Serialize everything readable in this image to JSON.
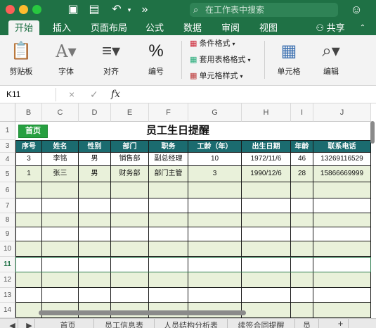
{
  "search": {
    "placeholder": "在工作表中搜索"
  },
  "colors": {
    "accent": "#1f7145",
    "header_fill": "#1b6b6f",
    "band_fill": "#e9f1da",
    "home_button": "#27a041"
  },
  "tabs": [
    {
      "label": "开始",
      "active": true
    },
    {
      "label": "插入"
    },
    {
      "label": "页面布局"
    },
    {
      "label": "公式"
    },
    {
      "label": "数据"
    },
    {
      "label": "审阅"
    },
    {
      "label": "视图"
    }
  ],
  "share_label": "共享",
  "ribbon": {
    "clipboard": "剪贴板",
    "font": "字体",
    "align": "对齐",
    "number": "编号",
    "number_icon": "%",
    "conditional_format": "条件格式",
    "table_format": "套用表格格式",
    "cell_style": "单元格样式",
    "cells": "单元格",
    "edit": "编辑"
  },
  "formula_bar": {
    "name_box": "K11",
    "cancel": "×",
    "confirm": "✓",
    "fx": "fx"
  },
  "columns": [
    "B",
    "C",
    "D",
    "E",
    "F",
    "G",
    "H",
    "I",
    "J"
  ],
  "rows": [
    "1",
    "3",
    "4",
    "5",
    "6",
    "7",
    "8",
    "9",
    "10",
    "11",
    "12",
    "13",
    "14"
  ],
  "selected_row": "11",
  "sheet": {
    "home_button": "首页",
    "title": "员工生日提醒",
    "headers": [
      "序号",
      "姓名",
      "性别",
      "部门",
      "职务",
      "工龄（年）",
      "出生日期",
      "年龄",
      "联系电话"
    ],
    "records": [
      [
        "3",
        "李铭",
        "男",
        "销售部",
        "副总经理",
        "10",
        "1972/11/6",
        "46",
        "13269116529"
      ],
      [
        "1",
        "张三",
        "男",
        "财务部",
        "部门主管",
        "3",
        "1990/12/6",
        "28",
        "15866669999"
      ]
    ]
  },
  "sheet_tabs": [
    "首页",
    "员工信息表",
    "人员结构分析表",
    "续签合同提醒",
    "员"
  ]
}
